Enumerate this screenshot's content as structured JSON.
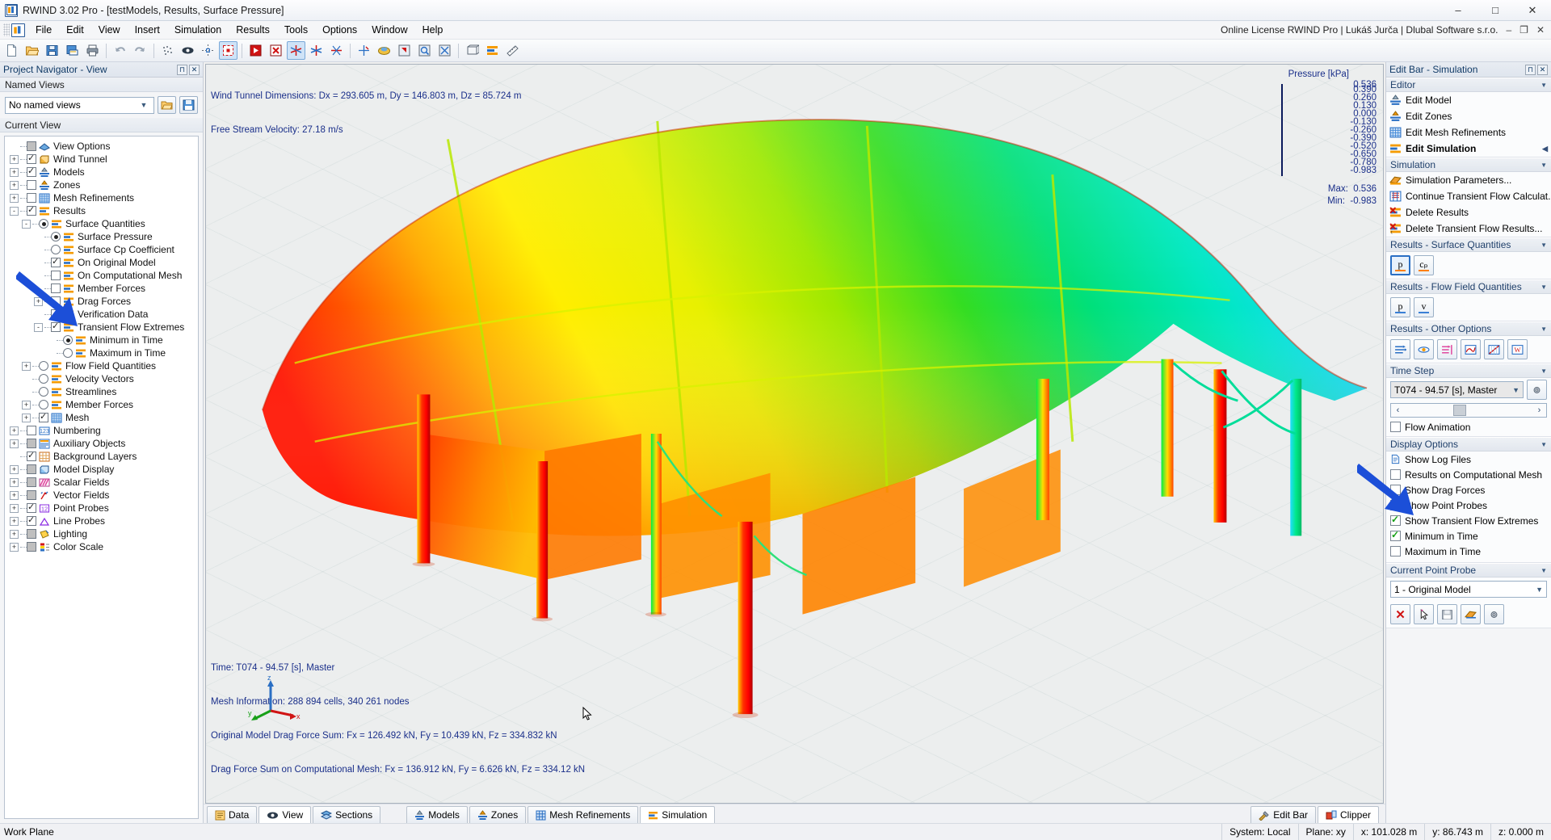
{
  "window": {
    "title": "RWIND 3.02 Pro - [testModels, Results, Surface Pressure]",
    "app_icon": "rwind-icon",
    "minimize": "–",
    "maximize": "□",
    "close": "✕"
  },
  "menu": {
    "items": [
      "File",
      "Edit",
      "View",
      "Insert",
      "Simulation",
      "Results",
      "Tools",
      "Options",
      "Window",
      "Help"
    ],
    "license": "Online License RWIND Pro | Lukáš Jurča | Dlubal Software s.r.o.",
    "mdi_minimize": "–",
    "mdi_restore": "❐",
    "mdi_close": "✕"
  },
  "toolbar": {
    "groups": [
      [
        "new-document-icon",
        "open-folder-icon",
        "save-icon",
        "save-as-icon",
        "print-icon"
      ],
      [
        "undo-icon",
        "redo-icon"
      ],
      [
        "render-mesh-icon",
        "hidden-view-icon",
        "snap-grid-icon",
        "selection-box-icon"
      ],
      [
        "zone-select-icon",
        "zone-deselect-icon",
        "rotate-view-icon",
        "rotate-view-2-icon",
        "rotate-view-3-icon"
      ],
      [
        "pan-view-icon",
        "shade-view-icon",
        "previous-view-icon",
        "zoom-window-icon",
        "zoom-all-icon"
      ],
      [
        "wireframe-icon",
        "results-icon",
        "measure-icon"
      ]
    ]
  },
  "left_panel": {
    "caption": "Project Navigator - View",
    "caption_buttons": [
      "pin-icon",
      "close-icon"
    ],
    "named_views_group": "Named Views",
    "named_views_value": "No named views",
    "named_views_buttons": [
      "manage-views-icon",
      "save-view-icon"
    ],
    "current_view_group": "Current View",
    "tree": [
      {
        "id": "view-options",
        "label": "View Options",
        "depth": 0,
        "expander": "",
        "control": "cb-gray",
        "icon": "view-options-icon"
      },
      {
        "id": "wind-tunnel",
        "label": "Wind Tunnel",
        "depth": 0,
        "expander": "+",
        "control": "cb-checked",
        "icon": "wind-tunnel-icon"
      },
      {
        "id": "models",
        "label": "Models",
        "depth": 0,
        "expander": "+",
        "control": "cb-checked",
        "icon": "model-icon"
      },
      {
        "id": "zones",
        "label": "Zones",
        "depth": 0,
        "expander": "+",
        "control": "cb",
        "icon": "zones-icon"
      },
      {
        "id": "mesh-refinements",
        "label": "Mesh Refinements",
        "depth": 0,
        "expander": "+",
        "control": "cb",
        "icon": "mesh-icon"
      },
      {
        "id": "results",
        "label": "Results",
        "depth": 0,
        "expander": "-",
        "control": "cb-checked",
        "icon": "results-icon"
      },
      {
        "id": "surface-quantities",
        "label": "Surface Quantities",
        "depth": 1,
        "expander": "-",
        "control": "rb-sel",
        "icon": "results-icon"
      },
      {
        "id": "surface-pressure",
        "label": "Surface Pressure",
        "depth": 2,
        "expander": "",
        "control": "rb-sel",
        "icon": "results-icon"
      },
      {
        "id": "surface-cp-coefficient",
        "label": "Surface Cp Coefficient",
        "depth": 2,
        "expander": "",
        "control": "rb",
        "icon": "results-icon"
      },
      {
        "id": "on-original-model",
        "label": "On Original Model",
        "depth": 2,
        "expander": "",
        "control": "cb-checked",
        "icon": "results-icon"
      },
      {
        "id": "on-computational-mesh",
        "label": "On Computational Mesh",
        "depth": 2,
        "expander": "",
        "control": "cb",
        "icon": "results-icon"
      },
      {
        "id": "member-forces-sq",
        "label": "Member Forces",
        "depth": 2,
        "expander": "",
        "control": "cb",
        "icon": "results-icon"
      },
      {
        "id": "drag-forces",
        "label": "Drag Forces",
        "depth": 2,
        "expander": "+",
        "control": "cb",
        "icon": "results-icon"
      },
      {
        "id": "verification-data",
        "label": "Verification Data",
        "depth": 2,
        "expander": "",
        "control": "cb",
        "icon": "results-icon"
      },
      {
        "id": "transient-flow-extremes",
        "label": "Transient Flow Extremes",
        "depth": 2,
        "expander": "-",
        "control": "cb-checked",
        "icon": "results-icon"
      },
      {
        "id": "minimum-in-time",
        "label": "Minimum in Time",
        "depth": 3,
        "expander": "",
        "control": "rb-sel",
        "icon": "results-icon"
      },
      {
        "id": "maximum-in-time",
        "label": "Maximum in Time",
        "depth": 3,
        "expander": "",
        "control": "rb",
        "icon": "results-icon"
      },
      {
        "id": "flow-field-quantities",
        "label": "Flow Field Quantities",
        "depth": 1,
        "expander": "+",
        "control": "rb",
        "icon": "results-icon"
      },
      {
        "id": "velocity-vectors",
        "label": "Velocity Vectors",
        "depth": 1,
        "expander": "",
        "control": "rb",
        "icon": "results-icon"
      },
      {
        "id": "streamlines",
        "label": "Streamlines",
        "depth": 1,
        "expander": "",
        "control": "rb",
        "icon": "results-icon"
      },
      {
        "id": "member-forces",
        "label": "Member Forces",
        "depth": 1,
        "expander": "+",
        "control": "rb",
        "icon": "results-icon"
      },
      {
        "id": "mesh",
        "label": "Mesh",
        "depth": 1,
        "expander": "+",
        "control": "cb-checked",
        "icon": "mesh-icon"
      },
      {
        "id": "numbering",
        "label": "Numbering",
        "depth": 0,
        "expander": "+",
        "control": "cb",
        "icon": "numbering-icon"
      },
      {
        "id": "auxiliary-objects",
        "label": "Auxiliary Objects",
        "depth": 0,
        "expander": "+",
        "control": "cb-gray",
        "icon": "auxiliary-icon"
      },
      {
        "id": "background-layers",
        "label": "Background Layers",
        "depth": 0,
        "expander": "",
        "control": "cb-checked",
        "icon": "background-layers-icon"
      },
      {
        "id": "model-display",
        "label": "Model Display",
        "depth": 0,
        "expander": "+",
        "control": "cb-gray",
        "icon": "model-display-icon"
      },
      {
        "id": "scalar-fields",
        "label": "Scalar Fields",
        "depth": 0,
        "expander": "+",
        "control": "cb-gray",
        "icon": "scalar-fields-icon"
      },
      {
        "id": "vector-fields",
        "label": "Vector Fields",
        "depth": 0,
        "expander": "+",
        "control": "cb-gray",
        "icon": "vector-fields-icon"
      },
      {
        "id": "point-probes",
        "label": "Point Probes",
        "depth": 0,
        "expander": "+",
        "control": "cb-checked",
        "icon": "point-probes-icon"
      },
      {
        "id": "line-probes",
        "label": "Line Probes",
        "depth": 0,
        "expander": "+",
        "control": "cb-checked",
        "icon": "line-probes-icon"
      },
      {
        "id": "lighting",
        "label": "Lighting",
        "depth": 0,
        "expander": "+",
        "control": "cb-gray",
        "icon": "lighting-icon"
      },
      {
        "id": "color-scale",
        "label": "Color Scale",
        "depth": 0,
        "expander": "+",
        "control": "cb-gray",
        "icon": "color-scale-icon"
      }
    ]
  },
  "viewport": {
    "top_line_1": "Wind Tunnel Dimensions: Dx = 293.605 m, Dy = 146.803 m, Dz = 85.724 m",
    "top_line_2": "Free Stream Velocity: 27.18 m/s",
    "bottom_lines": [
      "Time: T074 - 94.57 [s], Master",
      "Mesh Information: 288 894 cells, 340 261 nodes",
      "Original Model Drag Force Sum: Fx = 126.492 kN, Fy = 10.439 kN, Fz = 334.832 kN",
      "Drag Force Sum on Computational Mesh: Fx = 136.912 kN, Fy = 6.626 kN, Fz = 334.12 kN"
    ],
    "axis_triad": {
      "x": "x",
      "y": "y",
      "z": "z"
    }
  },
  "legend": {
    "title": "Pressure [kPa]",
    "values": [
      "0.536",
      "0.390",
      "0.260",
      "0.130",
      "0.000",
      "-0.130",
      "-0.260",
      "-0.390",
      "-0.520",
      "-0.650",
      "-0.780",
      "-0.983"
    ],
    "colors": [
      "#b00000",
      "#ff0000",
      "#ff8c00",
      "#cccc00",
      "#ffff00",
      "#00e000",
      "#00dd88",
      "#00ffff",
      "#4aaef0",
      "#8a8af0",
      "#0000ee"
    ],
    "max_label": "Max:",
    "max_value": "0.536",
    "min_label": "Min:",
    "min_value": "-0.983"
  },
  "right_panel": {
    "caption": "Edit Bar - Simulation",
    "caption_buttons": [
      "pin-icon",
      "close-icon"
    ],
    "groups": [
      {
        "id": "editor",
        "title": "Editor",
        "type": "items",
        "items": [
          {
            "label": "Edit Model",
            "icon": "model-icon",
            "bold": false,
            "marker": ""
          },
          {
            "label": "Edit Zones",
            "icon": "zones-icon",
            "bold": false,
            "marker": ""
          },
          {
            "label": "Edit Mesh Refinements",
            "icon": "mesh-icon",
            "bold": false,
            "marker": ""
          },
          {
            "label": "Edit Simulation",
            "icon": "results-icon",
            "bold": true,
            "marker": "◀"
          }
        ]
      },
      {
        "id": "simulation",
        "title": "Simulation",
        "type": "items",
        "items": [
          {
            "label": "Simulation Parameters...",
            "icon": "sim-params-icon",
            "bold": false,
            "marker": ""
          },
          {
            "label": "Continue Transient Flow Calculat...",
            "icon": "continue-calc-icon",
            "bold": false,
            "marker": ""
          },
          {
            "label": "Delete Results",
            "icon": "delete-results-icon",
            "bold": false,
            "marker": ""
          },
          {
            "label": "Delete Transient Flow Results...",
            "icon": "delete-transient-icon",
            "bold": false,
            "marker": ""
          }
        ]
      },
      {
        "id": "results-surface-quantities",
        "title": "Results - Surface Quantities",
        "type": "buttons",
        "buttons": [
          {
            "name": "surface-pressure-button",
            "glyph": "p",
            "selected": true,
            "accent": "#ff7f00"
          },
          {
            "name": "surface-cp-button",
            "glyph": "cₚ",
            "selected": false,
            "accent": "#ff7f00"
          }
        ]
      },
      {
        "id": "results-flow-field-quantities",
        "title": "Results - Flow Field Quantities",
        "type": "buttons",
        "buttons": [
          {
            "name": "flow-pressure-button",
            "glyph": "p",
            "selected": false,
            "accent": "#3a7fd5"
          },
          {
            "name": "flow-velocity-button",
            "glyph": "v",
            "selected": false,
            "accent": "#3a7fd5"
          }
        ]
      },
      {
        "id": "results-other-options",
        "title": "Results - Other Options",
        "type": "icon-buttons",
        "buttons": [
          {
            "name": "velocity-vectors-button",
            "icon": "arrows-icon"
          },
          {
            "name": "streamlines-button",
            "icon": "streamlines-icon"
          },
          {
            "name": "flow-lines-button",
            "icon": "flow-lines-icon"
          },
          {
            "name": "result-diagram-button",
            "icon": "diagram-icon"
          },
          {
            "name": "result-chart-button",
            "icon": "chart-icon"
          },
          {
            "name": "report-button",
            "icon": "word-icon"
          }
        ]
      },
      {
        "id": "time-step",
        "title": "Time Step",
        "type": "timestep",
        "value": "T074 - 94.57 [s], Master",
        "settings_icon": "gear-icon",
        "slider_left": "‹",
        "slider_right": "›",
        "animation_label": "Flow Animation",
        "animation_checked": false
      },
      {
        "id": "display-options",
        "title": "Display Options",
        "type": "checks",
        "items": [
          {
            "label": "Show Log Files",
            "checked": null,
            "icon": "log-file-icon"
          },
          {
            "label": "Results on Computational Mesh",
            "checked": false,
            "icon": ""
          },
          {
            "label": "Show Drag Forces",
            "checked": false,
            "icon": ""
          },
          {
            "label": "Show Point Probes",
            "checked": true,
            "icon": ""
          },
          {
            "label": "Show Transient Flow Extremes",
            "checked": true,
            "icon": ""
          },
          {
            "label": "Minimum in Time",
            "checked": true,
            "icon": ""
          },
          {
            "label": "Maximum in Time",
            "checked": false,
            "icon": ""
          }
        ]
      },
      {
        "id": "current-point-probe",
        "title": "Current Point Probe",
        "type": "probe",
        "value": "1 - Original Model",
        "buttons": [
          {
            "name": "delete-probe-button",
            "glyph": "✕",
            "color": "#d01414"
          },
          {
            "name": "pick-probe-button",
            "glyph": "pick-icon",
            "color": "#333"
          },
          {
            "name": "save-probe-button",
            "glyph": "save-icon",
            "color": "#999"
          },
          {
            "name": "probe-table-button",
            "glyph": "table-icon",
            "color": "#2a6fc4"
          },
          {
            "name": "probe-settings-button",
            "glyph": "gear-icon",
            "color": "#555"
          }
        ]
      }
    ]
  },
  "tabs": {
    "left": [
      {
        "label": "Data",
        "icon": "data-icon",
        "active": false
      },
      {
        "label": "View",
        "icon": "eye-icon",
        "active": true
      },
      {
        "label": "Sections",
        "icon": "sections-icon",
        "active": false
      }
    ],
    "center": [
      {
        "label": "Models",
        "icon": "model-icon",
        "active": false
      },
      {
        "label": "Zones",
        "icon": "zones-icon",
        "active": false
      },
      {
        "label": "Mesh Refinements",
        "icon": "mesh-icon",
        "active": false
      },
      {
        "label": "Simulation",
        "icon": "results-icon",
        "active": true
      }
    ],
    "right": [
      {
        "label": "Edit Bar",
        "icon": "tools-icon",
        "active": false
      },
      {
        "label": "Clipper",
        "icon": "clipper-icon",
        "active": true
      }
    ]
  },
  "status": {
    "left": "Work Plane",
    "cells": [
      "System: Local",
      "Plane: xy",
      "x:  101.028 m",
      "y:  86.743 m",
      "z:  0.000 m"
    ]
  }
}
